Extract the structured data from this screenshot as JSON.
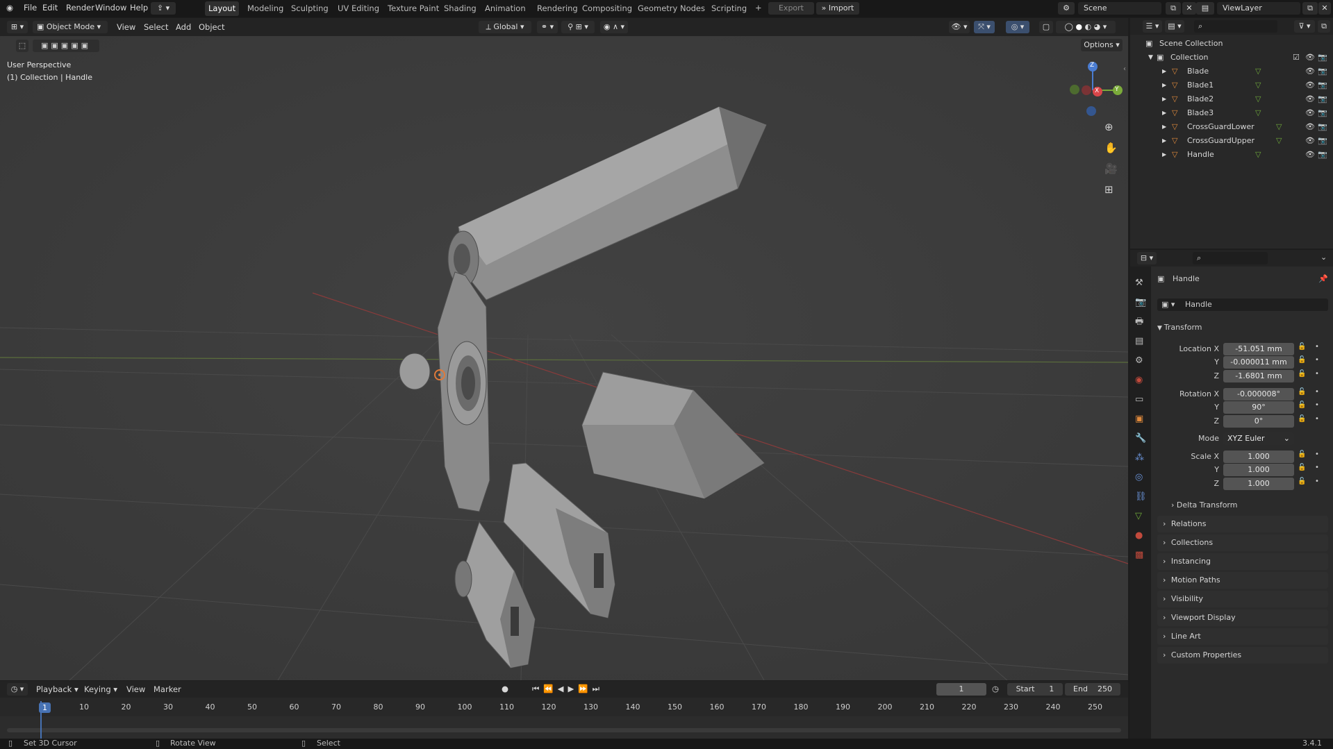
{
  "menu": {
    "file": "File",
    "edit": "Edit",
    "render": "Render",
    "window": "Window",
    "help": "Help"
  },
  "workspaces": [
    "Layout",
    "Modeling",
    "Sculpting",
    "UV Editing",
    "Texture Paint",
    "Shading",
    "Animation",
    "Rendering",
    "Compositing",
    "Geometry Nodes",
    "Scripting"
  ],
  "top_right": {
    "export": "Export",
    "import": "Import",
    "scene": "Scene",
    "view_layer": "ViewLayer"
  },
  "viewport_header": {
    "mode": "Object Mode",
    "view": "View",
    "select": "Select",
    "add": "Add",
    "object": "Object",
    "orientation": "Global",
    "options": "Options"
  },
  "viewport_overlay": {
    "perspective": "User Perspective",
    "collection_info": "(1) Collection | Handle"
  },
  "gizmo": {
    "x": "X",
    "y": "Y",
    "z": "Z"
  },
  "outliner": {
    "scene_collection": "Scene Collection",
    "collection": "Collection",
    "items": [
      "Blade",
      "Blade1",
      "Blade2",
      "Blade3",
      "CrossGuardLower",
      "CrossGuardUpper",
      "Handle"
    ]
  },
  "properties": {
    "object_name": "Handle",
    "data_name": "Handle",
    "transform": "Transform",
    "location": {
      "label": "Location X",
      "x": "-51.051 mm",
      "y": "-0.000011 mm",
      "z": "-1.6801 mm"
    },
    "rotation": {
      "label": "Rotation X",
      "x": "-0.000008°",
      "y": "90°",
      "z": "0°"
    },
    "mode_label": "Mode",
    "mode_value": "XYZ Euler",
    "scale": {
      "label": "Scale X",
      "x": "1.000",
      "y": "1.000",
      "z": "1.000"
    },
    "axis_y": "Y",
    "axis_z": "Z",
    "delta_transform": "Delta Transform",
    "panels": [
      "Relations",
      "Collections",
      "Instancing",
      "Motion Paths",
      "Visibility",
      "Viewport Display",
      "Line Art",
      "Custom Properties"
    ]
  },
  "timeline": {
    "playback": "Playback",
    "keying": "Keying",
    "view": "View",
    "marker": "Marker",
    "current_frame": "1",
    "start_label": "Start",
    "start": "1",
    "end_label": "End",
    "end": "250",
    "ticks": [
      "1",
      "10",
      "20",
      "30",
      "40",
      "50",
      "60",
      "70",
      "80",
      "90",
      "100",
      "110",
      "120",
      "130",
      "140",
      "150",
      "160",
      "170",
      "180",
      "190",
      "200",
      "210",
      "220",
      "230",
      "240",
      "250"
    ]
  },
  "status": {
    "set_cursor": "Set 3D Cursor",
    "rotate": "Rotate View",
    "select": "Select",
    "version": "3.4.1"
  },
  "colors": {
    "accent_blue": "#4772b3",
    "axis_red": "#d9464a",
    "axis_green": "#6ea83a",
    "object_orange": "#e08a3c"
  }
}
